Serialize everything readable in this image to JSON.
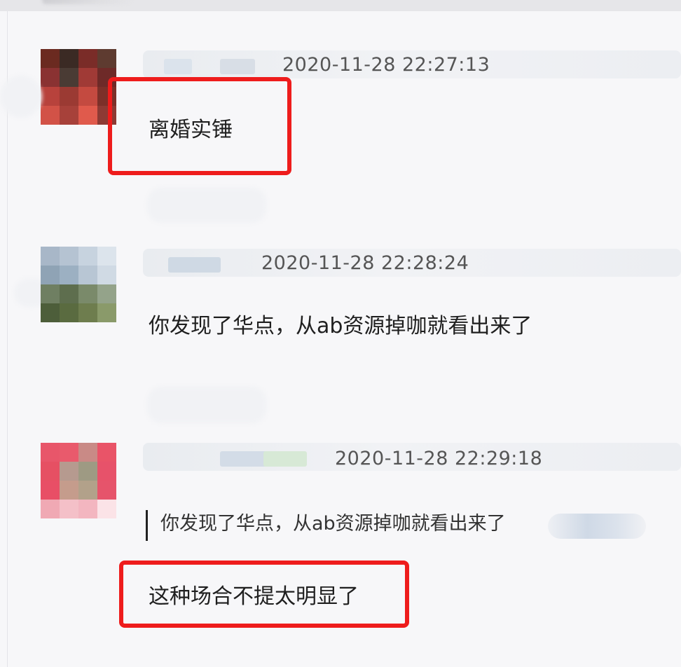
{
  "messages": [
    {
      "timestamp": "2020-11-28 22:27:13",
      "text": "离婚实锤",
      "avatar_colors": [
        "#6b2a20",
        "#3b2a24",
        "#7a2c28",
        "#5e3b30",
        "#8a3232",
        "#4a3b34",
        "#a03a36",
        "#6e2a28",
        "#b8423c",
        "#9b3a33",
        "#c44a40",
        "#7c3029",
        "#d25247",
        "#a7413a",
        "#e05a4c",
        "#8d3a34"
      ]
    },
    {
      "timestamp": "2020-11-28 22:28:24",
      "text": "你发现了华点，从ab资源掉咖就看出来了",
      "avatar_colors": [
        "#a8b7c8",
        "#b5c3d2",
        "#c7d3df",
        "#dce4ec",
        "#8fa3b5",
        "#9cb0c2",
        "#b8c6d4",
        "#d0dae4",
        "#6f7f62",
        "#5e6e4e",
        "#7a8a6a",
        "#94a38a",
        "#4d5e3a",
        "#5a6b40",
        "#6e7d4e",
        "#8a9a6a"
      ]
    },
    {
      "timestamp": "2020-11-28 22:29:18",
      "quote": "你发现了华点，从ab资源掉咖就看出来了",
      "text": "这种场合不提太明显了",
      "avatar_colors": [
        "#e8566a",
        "#e95a6c",
        "#c98a86",
        "#e95468",
        "#e65063",
        "#b69a8f",
        "#9e9a83",
        "#e7526a",
        "#e84f66",
        "#c59c8c",
        "#b2a18a",
        "#e6546b",
        "#f0a9b4",
        "#f4c0c8",
        "#f3b6c0",
        "#fbe3e7"
      ]
    }
  ],
  "colors": {
    "highlight_box": "#ee1c1c",
    "background": "#f7f7f9"
  }
}
